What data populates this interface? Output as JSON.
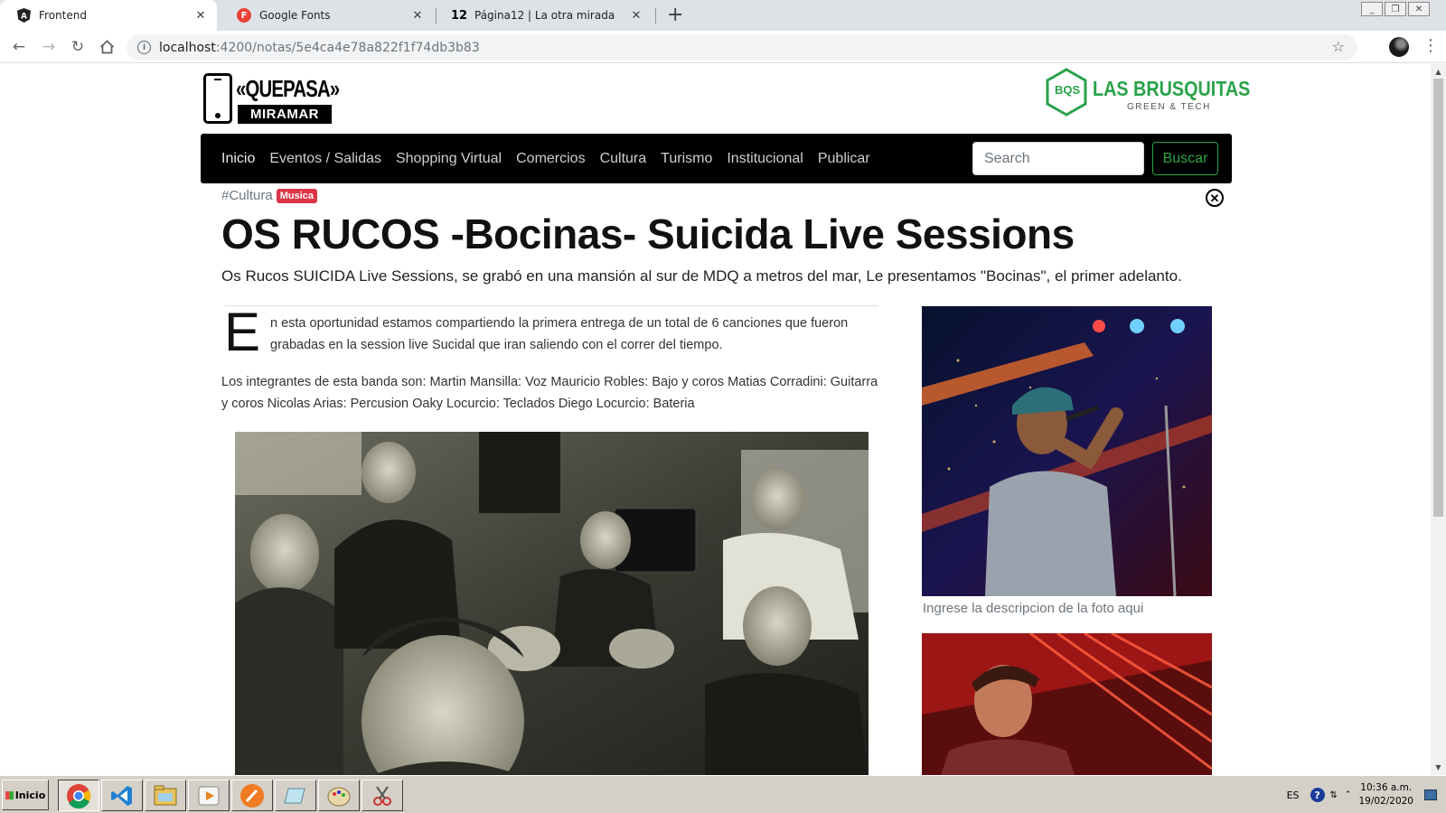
{
  "browser": {
    "tabs": [
      {
        "title": "Frontend",
        "favicon": "angular-icon",
        "active": true
      },
      {
        "title": "Google Fonts",
        "favicon": "google-fonts-icon",
        "active": false
      },
      {
        "title": "Página12 | La otra mirada",
        "favicon": "pagina12-icon",
        "favicon_text": "12",
        "active": false
      }
    ],
    "url_host": "localhost",
    "url_path": ":4200/notas/5e4ca4e78a822f1f74db3b83"
  },
  "site": {
    "logo_left": {
      "top": "«QUEPASA»",
      "bottom": "MIRAMAR"
    },
    "logo_right": {
      "badge": "BQS",
      "title": "LAS BRUSQUITAS",
      "subtitle": "GREEN & TECH"
    },
    "nav": [
      "Inicio",
      "Eventos / Salidas",
      "Shopping Virtual",
      "Comercios",
      "Cultura",
      "Turismo",
      "Institucional",
      "Publicar"
    ],
    "search": {
      "placeholder": "Search",
      "button": "Buscar"
    }
  },
  "article": {
    "category": "#Cultura",
    "badge": "Musica",
    "title": "OS RUCOS -Bocinas- Suicida Live Sessions",
    "lead": "Os Rucos SUICIDA Live Sessions, se grabó en una mansión al sur de MDQ a metros del mar, Le presentamos \"Bocinas\", el primer adelanto.",
    "dropcap": "E",
    "paragraph1": "n esta oportunidad estamos compartiendo la primera entrega de un total de 6 canciones que fueron grabadas en la session live Sucidal que iran saliendo con el correr del tiempo.",
    "paragraph2": "Los integrantes de esta banda son: Martin Mansilla: Voz Mauricio Robles: Bajo y coros Matias Corradini: Guitarra y coros Nicolas Arias: Percusion Oaky Locurcio: Teclados Diego Locurcio: Bateria",
    "photo_caption": "Ingrese la descripcion de la foto aqui"
  },
  "taskbar": {
    "start": "Inicio",
    "lang": "ES",
    "time": "10:36 a.m.",
    "date": "19/02/2020"
  },
  "colors": {
    "accent_green": "#28a745",
    "badge_red": "#dc3545",
    "navbar_bg": "#000000"
  }
}
